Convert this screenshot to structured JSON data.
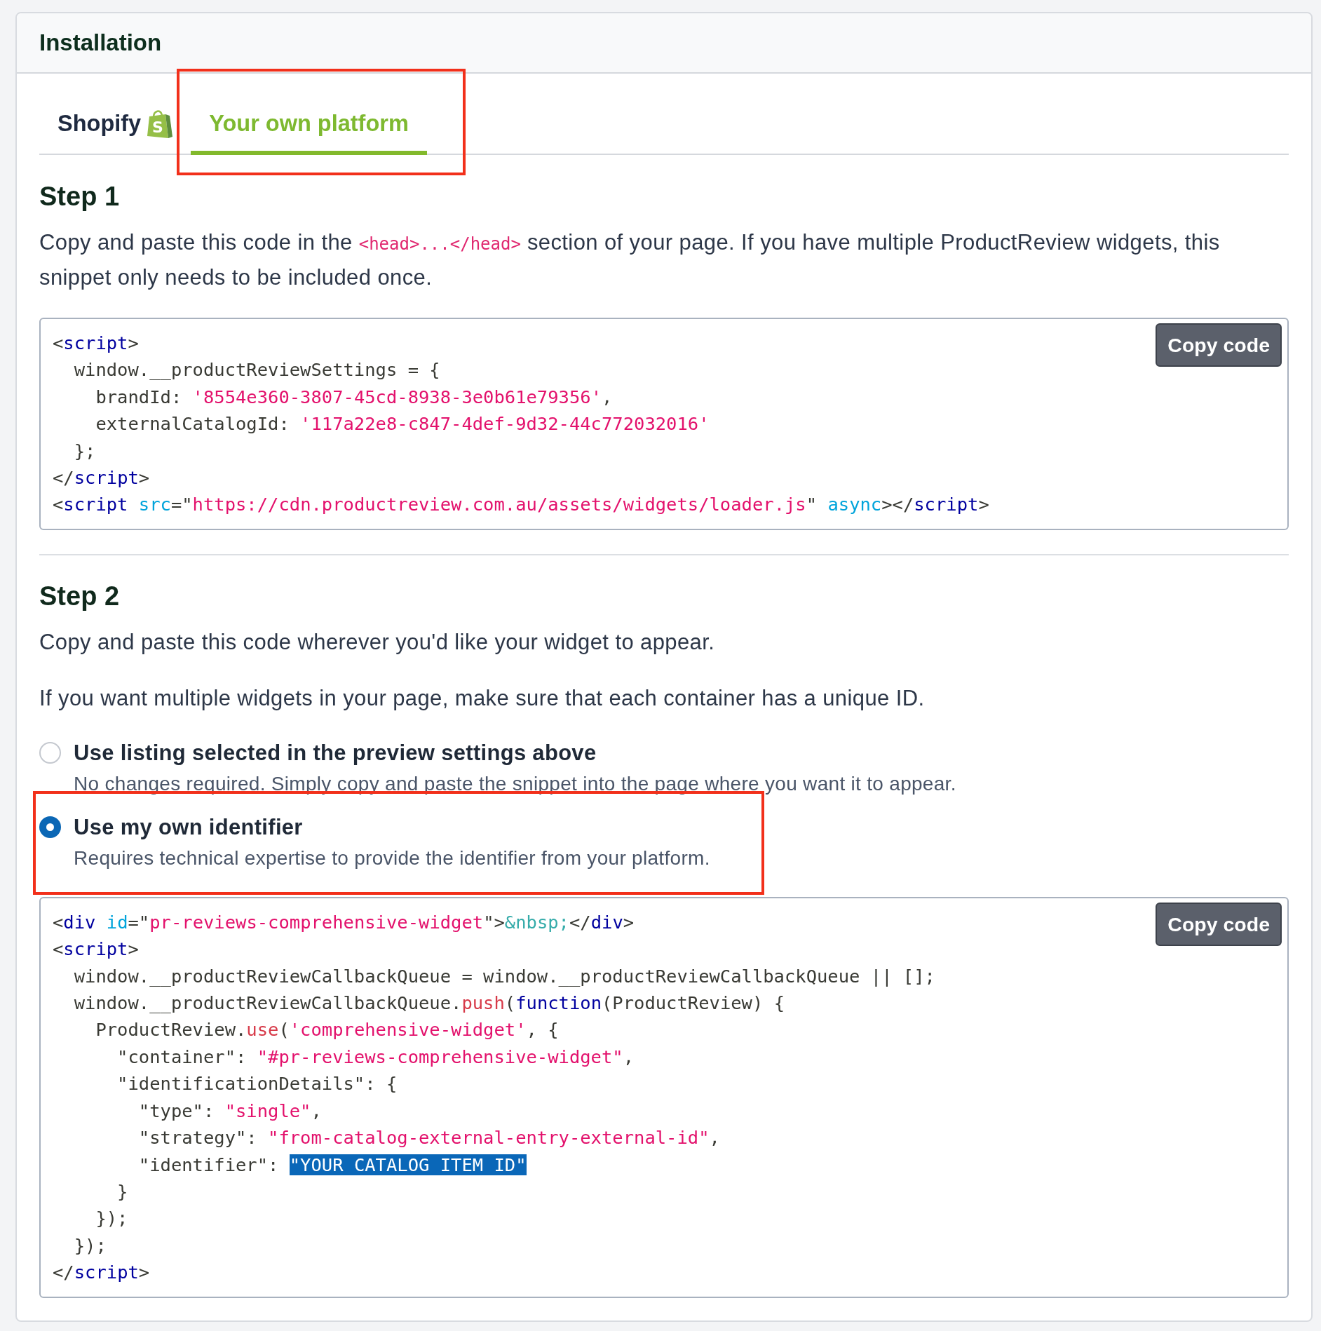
{
  "header": {
    "title": "Installation"
  },
  "tabs": [
    {
      "label": "Shopify",
      "selected": false,
      "highlighted": false,
      "icon_text": "S"
    },
    {
      "label": "Your own platform",
      "selected": true,
      "highlighted": true
    }
  ],
  "steps": [
    {
      "heading": "Step 1",
      "paragraphs": [
        {
          "segments": [
            {
              "kind": "text",
              "text": "Copy and paste this code in the "
            },
            {
              "kind": "code",
              "text": "<head>...</head>"
            },
            {
              "kind": "text",
              "text": " section of your page. If you have multiple ProductReview widgets, this snippet only needs to be included once."
            }
          ]
        }
      ],
      "code_block": {
        "button": "Copy code",
        "lines": [
          {
            "tokens": [
              {
                "kind": "plain",
                "text": "<"
              },
              {
                "kind": "tag",
                "text": "script"
              },
              {
                "kind": "plain",
                "text": ">"
              }
            ]
          },
          {
            "tokens": [
              {
                "kind": "plain",
                "text": "  window.__productReviewSettings = {"
              }
            ]
          },
          {
            "tokens": [
              {
                "kind": "plain",
                "text": "    brandId: "
              },
              {
                "kind": "string",
                "text": "'8554e360-3807-45cd-8938-3e0b61e79356'"
              },
              {
                "kind": "plain",
                "text": ","
              }
            ]
          },
          {
            "tokens": [
              {
                "kind": "plain",
                "text": "    externalCatalogId: "
              },
              {
                "kind": "string",
                "text": "'117a22e8-c847-4def-9d32-44c772032016'"
              }
            ]
          },
          {
            "tokens": [
              {
                "kind": "plain",
                "text": "  };"
              }
            ]
          },
          {
            "tokens": [
              {
                "kind": "plain",
                "text": "</"
              },
              {
                "kind": "tag",
                "text": "script"
              },
              {
                "kind": "plain",
                "text": ">"
              }
            ]
          },
          {
            "tokens": [
              {
                "kind": "plain",
                "text": "<"
              },
              {
                "kind": "tag",
                "text": "script "
              },
              {
                "kind": "attr",
                "text": "src"
              },
              {
                "kind": "plain",
                "text": "=\""
              },
              {
                "kind": "string",
                "text": "https://cdn.productreview.com.au/assets/widgets/loader.js"
              },
              {
                "kind": "plain",
                "text": "\" "
              },
              {
                "kind": "attr",
                "text": "async"
              },
              {
                "kind": "plain",
                "text": "></"
              },
              {
                "kind": "tag",
                "text": "script"
              },
              {
                "kind": "plain",
                "text": ">"
              }
            ]
          }
        ]
      }
    },
    {
      "heading": "Step 2",
      "paragraphs": [
        {
          "segments": [
            {
              "kind": "text",
              "text": "Copy and paste this code wherever you'd like your widget to appear."
            }
          ]
        },
        {
          "segments": [
            {
              "kind": "text",
              "text": "If you want multiple widgets in your page, make sure that each container has a unique ID."
            }
          ]
        }
      ],
      "options": [
        {
          "label": "Use listing selected in the preview settings above",
          "description": "No changes required. Simply copy and paste the snippet into the page where you want it to appear.",
          "selected": false,
          "highlighted": false
        },
        {
          "label": "Use my own identifier",
          "description": "Requires technical expertise to provide the identifier from your platform.",
          "selected": true,
          "highlighted": true
        }
      ],
      "code_block": {
        "button": "Copy code",
        "lines": [
          {
            "tokens": [
              {
                "kind": "plain",
                "text": "<"
              },
              {
                "kind": "tag",
                "text": "div "
              },
              {
                "kind": "attr",
                "text": "id"
              },
              {
                "kind": "plain",
                "text": "=\""
              },
              {
                "kind": "string",
                "text": "pr-reviews-comprehensive-widget"
              },
              {
                "kind": "plain",
                "text": "\">"
              },
              {
                "kind": "entity",
                "text": "&nbsp;"
              },
              {
                "kind": "plain",
                "text": "</"
              },
              {
                "kind": "tag",
                "text": "div"
              },
              {
                "kind": "plain",
                "text": ">"
              }
            ]
          },
          {
            "tokens": [
              {
                "kind": "plain",
                "text": "<"
              },
              {
                "kind": "tag",
                "text": "script"
              },
              {
                "kind": "plain",
                "text": ">"
              }
            ]
          },
          {
            "tokens": [
              {
                "kind": "plain",
                "text": "  window.__productReviewCallbackQueue = window.__productReviewCallbackQueue || [];"
              }
            ]
          },
          {
            "tokens": [
              {
                "kind": "plain",
                "text": "  window.__productReviewCallbackQueue."
              },
              {
                "kind": "function",
                "text": "push"
              },
              {
                "kind": "plain",
                "text": "("
              },
              {
                "kind": "keyword",
                "text": "function"
              },
              {
                "kind": "plain",
                "text": "(ProductReview) {"
              }
            ]
          },
          {
            "tokens": [
              {
                "kind": "plain",
                "text": "    ProductReview."
              },
              {
                "kind": "function",
                "text": "use"
              },
              {
                "kind": "plain",
                "text": "("
              },
              {
                "kind": "string",
                "text": "'comprehensive-widget'"
              },
              {
                "kind": "plain",
                "text": ", {"
              }
            ]
          },
          {
            "tokens": [
              {
                "kind": "plain",
                "text": "      \"container\": "
              },
              {
                "kind": "string",
                "text": "\"#pr-reviews-comprehensive-widget\""
              },
              {
                "kind": "plain",
                "text": ","
              }
            ]
          },
          {
            "tokens": [
              {
                "kind": "plain",
                "text": "      \"identificationDetails\": {"
              }
            ]
          },
          {
            "tokens": [
              {
                "kind": "plain",
                "text": "        \"type\": "
              },
              {
                "kind": "string",
                "text": "\"single\""
              },
              {
                "kind": "plain",
                "text": ","
              }
            ]
          },
          {
            "tokens": [
              {
                "kind": "plain",
                "text": "        \"strategy\": "
              },
              {
                "kind": "string",
                "text": "\"from-catalog-external-entry-external-id\""
              },
              {
                "kind": "plain",
                "text": ","
              }
            ]
          },
          {
            "tokens": [
              {
                "kind": "plain",
                "text": "        \"identifier\": "
              },
              {
                "kind": "selection",
                "text": "\"YOUR CATALOG ITEM ID\""
              }
            ]
          },
          {
            "tokens": [
              {
                "kind": "plain",
                "text": "      }"
              }
            ]
          },
          {
            "tokens": [
              {
                "kind": "plain",
                "text": "    });"
              }
            ]
          },
          {
            "tokens": [
              {
                "kind": "plain",
                "text": "  });"
              }
            ]
          },
          {
            "tokens": [
              {
                "kind": "plain",
                "text": "</"
              },
              {
                "kind": "tag",
                "text": "script"
              },
              {
                "kind": "plain",
                "text": ">"
              }
            ]
          }
        ]
      }
    }
  ]
}
